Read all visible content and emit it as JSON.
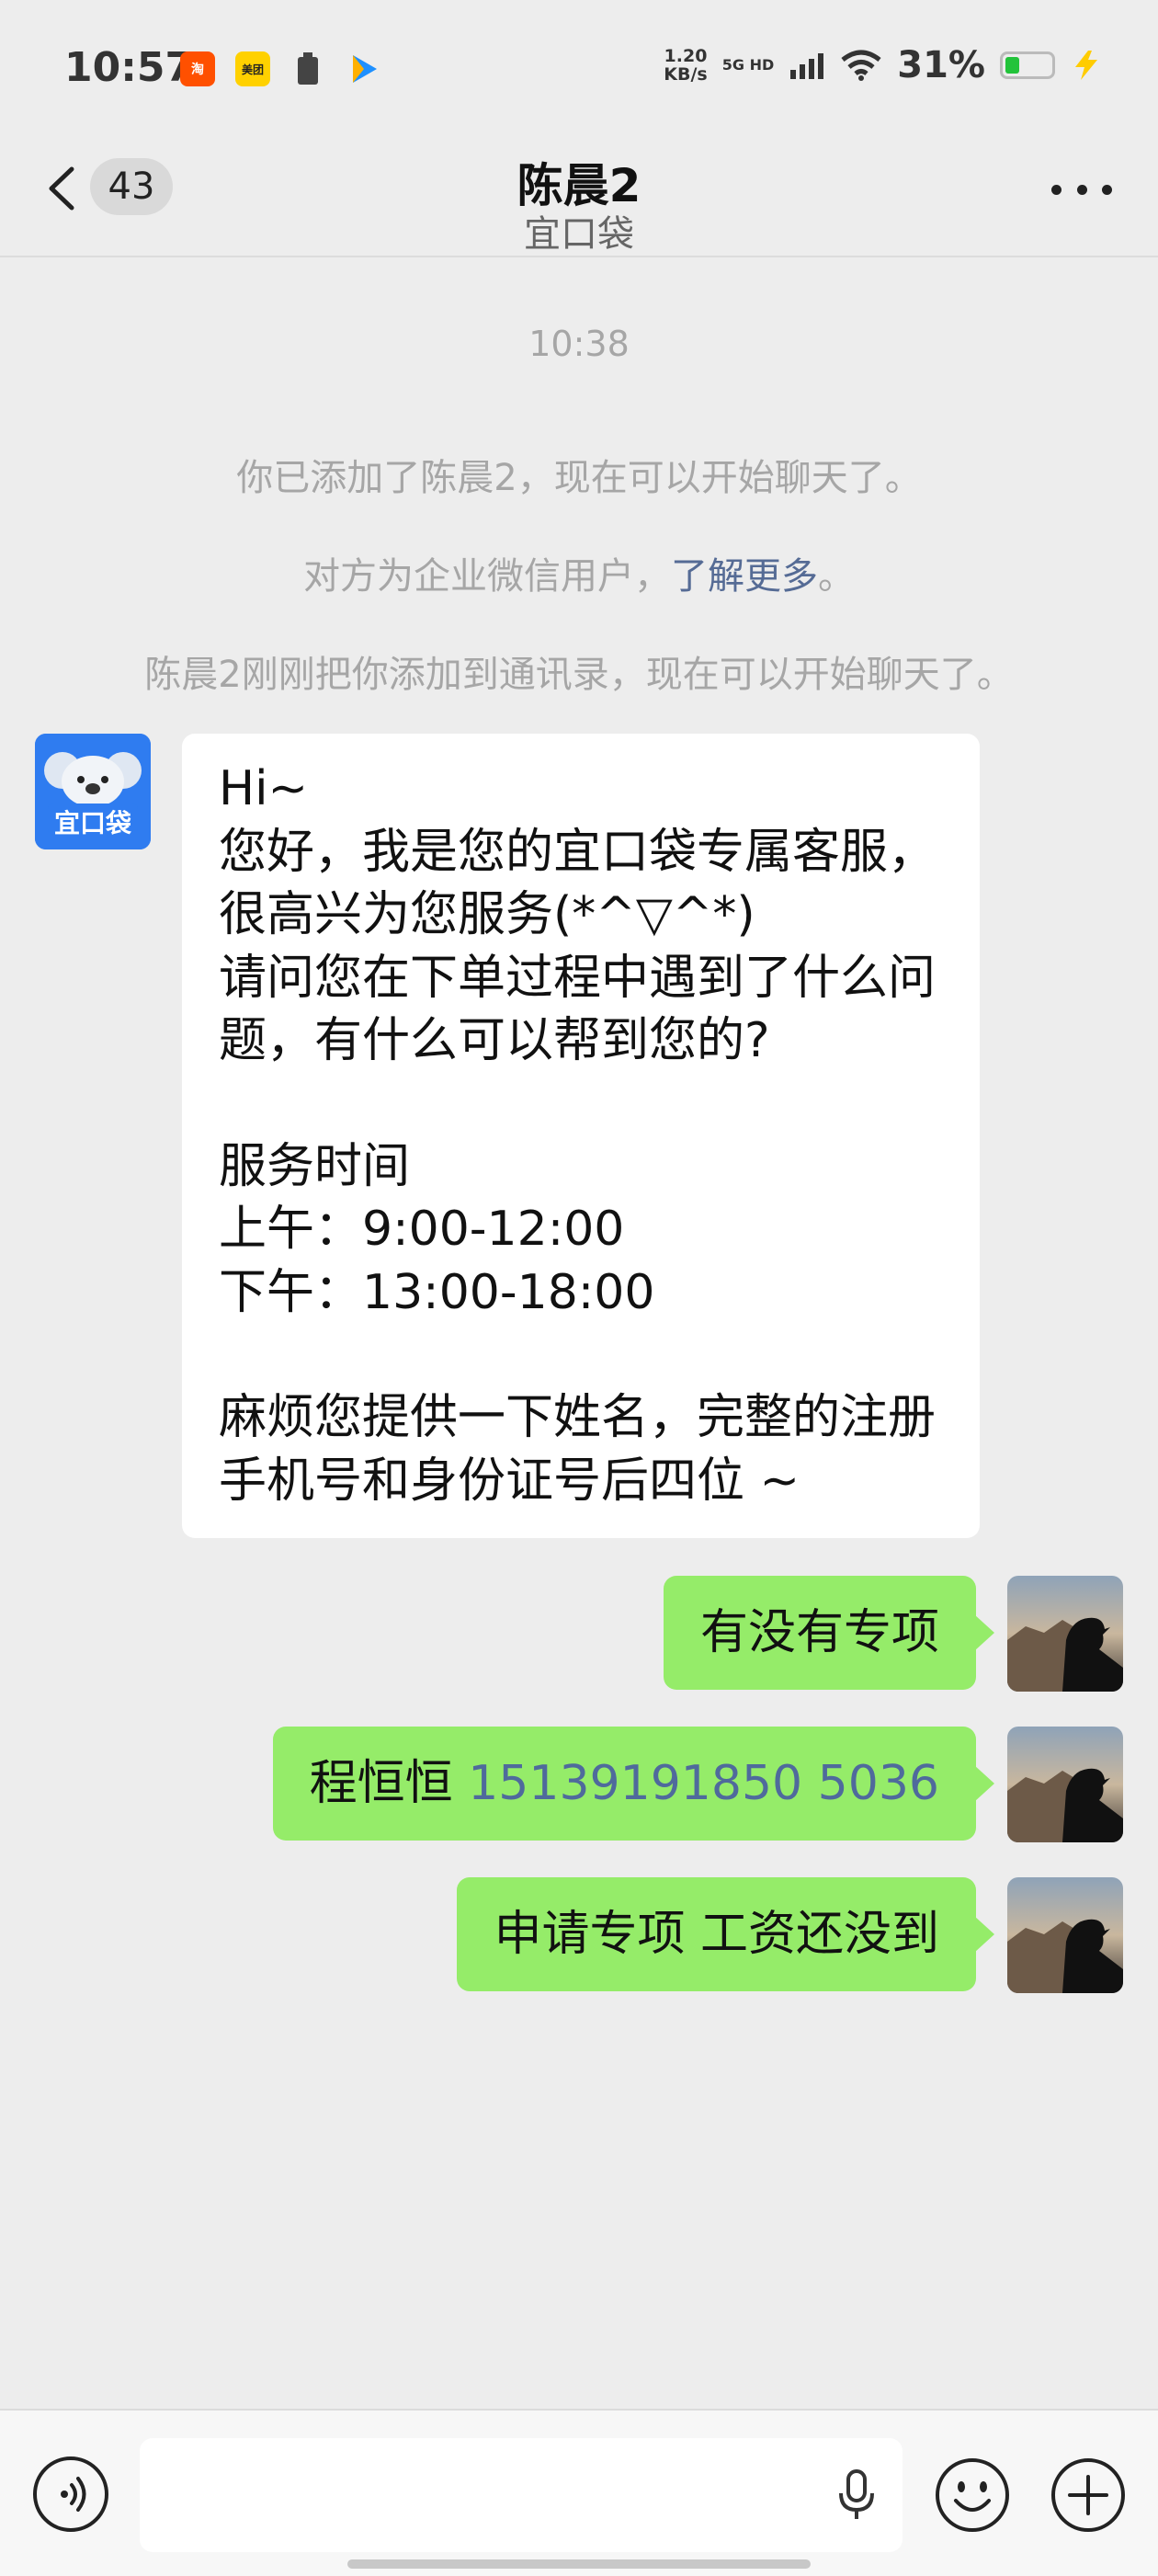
{
  "status_bar": {
    "time": "10:57",
    "net_speed_value": "1.20",
    "net_speed_unit": "KB/s",
    "network": "5G HD",
    "battery_percent": "31%",
    "battery_level": 0.31,
    "app_icons": [
      "taobao-icon",
      "meituan-icon",
      "battery-saver-icon",
      "video-app-icon"
    ],
    "app_icon_texts": [
      "淘",
      "美团",
      "",
      ""
    ]
  },
  "header": {
    "title": "陈晨2",
    "subtitle": "宜口袋",
    "unread_count": "43"
  },
  "chat": {
    "timestamp": "10:38",
    "system_messages": [
      "你已添加了陈晨2，现在可以开始聊天了。",
      "对方为企业微信用户，",
      "了解更多",
      "。",
      "陈晨2刚刚把你添加到通讯录，现在可以开始聊天了。"
    ],
    "incoming": {
      "avatar_label": "宜口袋",
      "lines": [
        "Hi~",
        "您好，我是您的宜口袋专属客服，",
        "很高兴为您服务(*^▽^*)",
        "请问您在下单过程中遇到了什么问",
        "题，有什么可以帮到您的?",
        "",
        "服务时间",
        "上午：9:00-12:00",
        "下午：13:00-18:00",
        "",
        "麻烦您提供一下姓名，完整的注册",
        "手机号和身份证号后四位 ~"
      ]
    },
    "outgoing": [
      {
        "text": "有没有专项"
      },
      {
        "name": "程恒恒 ",
        "phone": "15139191850 5036"
      },
      {
        "text": "申请专项 工资还没到"
      }
    ]
  },
  "colors": {
    "background": "#ededed",
    "outgoing_bubble": "#95ec69",
    "incoming_bubble": "#ffffff",
    "link": "#556b95",
    "battery_fill": "#22c33a"
  }
}
